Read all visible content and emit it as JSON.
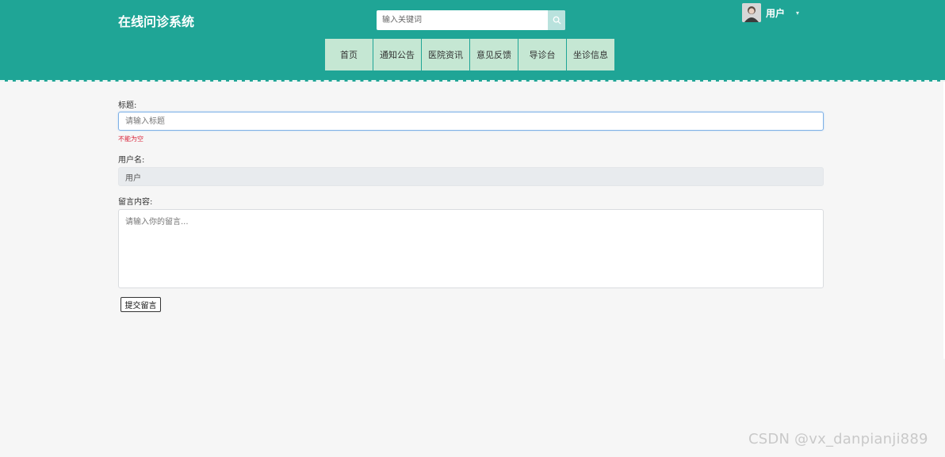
{
  "header": {
    "brand": "在线问诊系统",
    "search": {
      "placeholder": "输入关键词",
      "icon": "search-icon"
    },
    "user": {
      "name": "用户",
      "caret": "▾"
    },
    "nav": [
      "首页",
      "通知公告",
      "医院资讯",
      "意见反馈",
      "导诊台",
      "坐诊信息"
    ]
  },
  "form": {
    "title_label": "标题:",
    "title_placeholder": "请输入标题",
    "title_error": "不能为空",
    "username_label": "用户名:",
    "username_value": "用户",
    "content_label": "留言内容:",
    "content_placeholder": "请输入你的留言...",
    "submit_label": "提交留言"
  },
  "watermark": "CSDN @vx_danpianji889",
  "colors": {
    "header_bg": "#1fa596",
    "nav_bg": "#c5e7d3",
    "error": "#d9263c"
  }
}
